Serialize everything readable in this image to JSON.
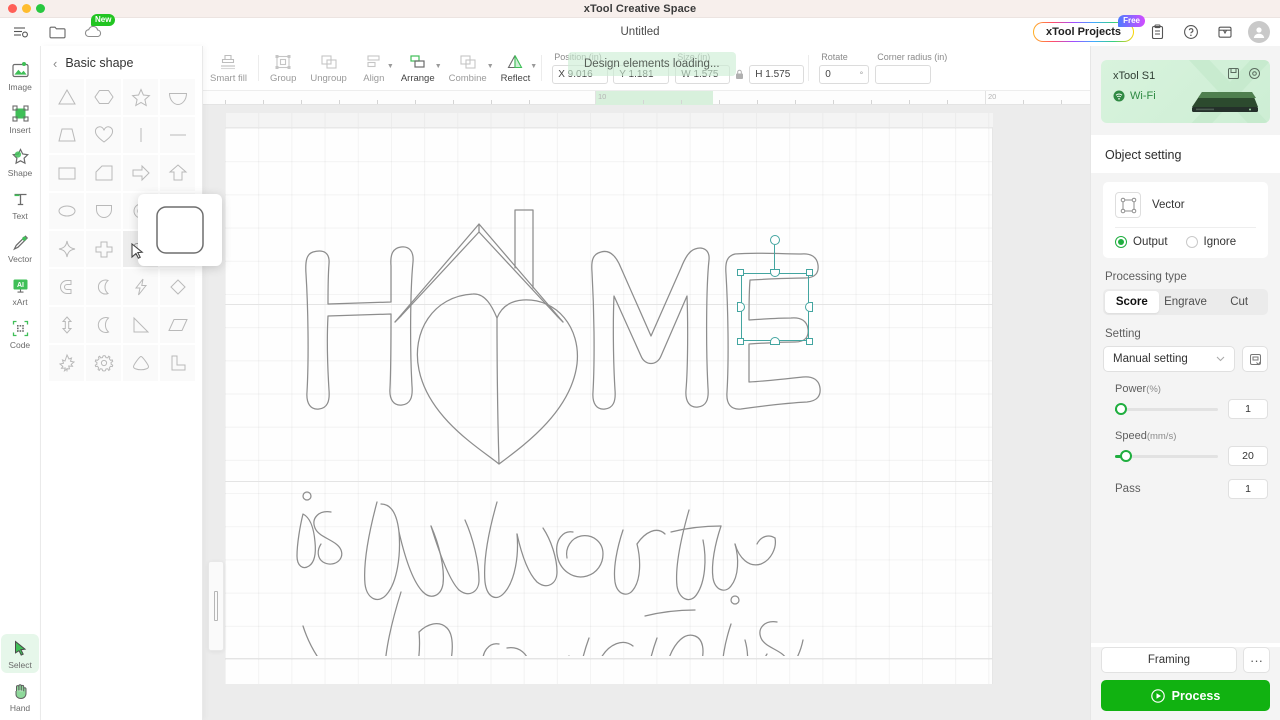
{
  "window": {
    "title": "xTool Creative Space",
    "traffic_lights": [
      "close",
      "minimize",
      "maximize"
    ]
  },
  "header": {
    "doc_title": "Untitled",
    "left_icons": [
      {
        "name": "menu-list-icon",
        "label": "Menu"
      },
      {
        "name": "folder-icon",
        "label": "Open project"
      },
      {
        "name": "cloud-icon",
        "label": "Cloud",
        "badge": "New"
      }
    ],
    "projects_button": {
      "label": "xTool Projects",
      "badge": "Free"
    },
    "right_icons": [
      {
        "name": "clipboard-icon",
        "label": "Tasks"
      },
      {
        "name": "help-icon",
        "label": "Help"
      },
      {
        "name": "store-icon",
        "label": "Store"
      },
      {
        "name": "avatar",
        "label": "Account"
      }
    ]
  },
  "rail": {
    "items": [
      {
        "id": "image",
        "label": "Image",
        "active": false
      },
      {
        "id": "insert",
        "label": "Insert",
        "active": false
      },
      {
        "id": "shape",
        "label": "Shape",
        "active": false
      },
      {
        "id": "text",
        "label": "Text",
        "active": false
      },
      {
        "id": "vector",
        "label": "Vector",
        "active": false
      },
      {
        "id": "xart",
        "label": "xArt",
        "active": false
      },
      {
        "id": "code",
        "label": "Code",
        "active": false
      }
    ],
    "bottom_items": [
      {
        "id": "select",
        "label": "Select",
        "active": true
      },
      {
        "id": "hand",
        "label": "Hand",
        "active": false
      }
    ]
  },
  "shape_panel": {
    "back_label": "‹",
    "title": "Basic shape",
    "hovered_index": 18,
    "preview_shape": "rounded-rectangle",
    "shapes": [
      "triangle",
      "hexagon",
      "star-5",
      "fan",
      "trapezoid",
      "heart",
      "vertical-line",
      "horizontal-line",
      "rectangle",
      "pentagon-left",
      "arrow-right",
      "arrow-up",
      "ellipse",
      "half-round",
      "ring",
      "star-4-thin",
      "sparkle-4",
      "cross",
      "rounded-rectangle",
      "teardrop",
      "c-bracket",
      "crescent-c",
      "lightning",
      "diamond",
      "double-arrow-vertical",
      "moon",
      "right-triangle",
      "parallelogram",
      "maple-leaf",
      "gear",
      "rounded-triangle",
      "l-shape"
    ]
  },
  "toolbar": {
    "tools": [
      {
        "id": "smart-fill",
        "label": "Smart fill",
        "enabled": false,
        "caret": false
      },
      {
        "id": "group",
        "label": "Group",
        "enabled": false,
        "caret": false
      },
      {
        "id": "ungroup",
        "label": "Ungroup",
        "enabled": false,
        "caret": false
      },
      {
        "id": "align",
        "label": "Align",
        "enabled": false,
        "caret": true
      },
      {
        "id": "arrange",
        "label": "Arrange",
        "enabled": true,
        "caret": true
      },
      {
        "id": "combine",
        "label": "Combine",
        "enabled": false,
        "caret": true
      },
      {
        "id": "reflect",
        "label": "Reflect",
        "enabled": true,
        "caret": true
      }
    ],
    "position": {
      "label": "Position (in)",
      "x_value": "X 9.016",
      "y_value": "Y 1.181"
    },
    "size": {
      "label": "Size (in)",
      "w_value": "W 1.575",
      "h_value": "H 1.575",
      "locked": true
    },
    "rotate": {
      "label": "Rotate",
      "value": "0",
      "unit": "°"
    },
    "corner_radius": {
      "label": "Corner radius (in)",
      "value": ""
    }
  },
  "toast": {
    "message": "Design elements loading..."
  },
  "canvas": {
    "ruler_labels": [
      "10",
      "20"
    ],
    "artwork_text_lines": [
      "HOME",
      "is where the",
      "heart is"
    ],
    "artwork_description": "house-outline-with-heart-lettering",
    "selection": {
      "visible": true
    }
  },
  "right_panel": {
    "device": {
      "name": "xTool S1",
      "connection": "Wi-Fi"
    },
    "object_setting": {
      "title": "Object setting",
      "object_type": "Vector",
      "output_label": "Output",
      "ignore_label": "Ignore",
      "output_selected": true
    },
    "processing": {
      "label": "Processing type",
      "options": [
        "Score",
        "Engrave",
        "Cut"
      ],
      "selected": "Score"
    },
    "setting": {
      "label": "Setting",
      "mode": "Manual setting",
      "params": [
        {
          "id": "power",
          "label": "Power",
          "unit": "(%)",
          "value": "1",
          "fill_pct": 1
        },
        {
          "id": "speed",
          "label": "Speed",
          "unit": "(mm/s)",
          "value": "20",
          "fill_pct": 4
        }
      ],
      "pass": {
        "label": "Pass",
        "value": "1"
      }
    },
    "actions": {
      "framing": "Framing",
      "more": "···",
      "process": "Process"
    }
  },
  "colors": {
    "accent_green": "#1fae3f",
    "process_green": "#11b211",
    "selection_teal": "#43a5a0",
    "panel_bg": "#f4f4f4"
  }
}
